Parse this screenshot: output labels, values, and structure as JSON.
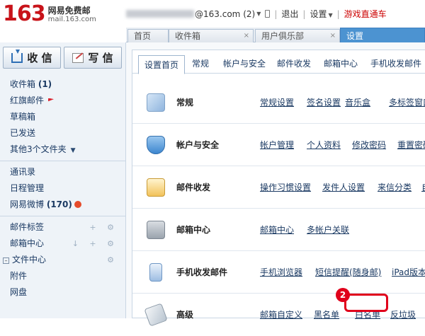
{
  "logo": {
    "number": "163",
    "name_cn": "网易免费邮",
    "domain": "mail.163.com"
  },
  "topbar": {
    "user_domain": "@163.com",
    "unread": "(2)",
    "logout": "退出",
    "settings": "设置",
    "game": "游戏直通车"
  },
  "tabs": [
    {
      "label": "首页"
    },
    {
      "label": "收件箱",
      "close": "×"
    },
    {
      "label": "用户俱乐部",
      "close": "×"
    },
    {
      "label": "设置"
    }
  ],
  "sidebar": {
    "receive": "收 信",
    "compose": "写 信",
    "items": [
      {
        "label": "收件箱",
        "count": "(1)"
      },
      {
        "label": "红旗邮件"
      },
      {
        "label": "草稿箱"
      },
      {
        "label": "已发送"
      },
      {
        "label": "其他3个文件夹"
      },
      {
        "label": "通讯录"
      },
      {
        "label": "日程管理"
      },
      {
        "label": "网易微博",
        "count": "(170)"
      },
      {
        "label": "邮件标签",
        "actions": "+ ⚙"
      },
      {
        "label": "邮箱中心",
        "actions": "↓ + ⚙"
      },
      {
        "label": "文件中心",
        "toggle": "–",
        "actions": "⚙"
      },
      {
        "label": "附件"
      },
      {
        "label": "网盘"
      }
    ]
  },
  "subtabs": [
    "设置首页",
    "常规",
    "帐户与安全",
    "邮件收发",
    "邮箱中心",
    "手机收发邮件"
  ],
  "rows": [
    {
      "title": "常规",
      "links": [
        "常规设置",
        "签名设置",
        "音乐盒",
        "多标签窗口"
      ]
    },
    {
      "title": "帐户与安全",
      "links": [
        "帐户管理",
        "个人资料",
        "修改密码",
        "重置密码"
      ]
    },
    {
      "title": "邮件收发",
      "links": [
        "操作习惯设置",
        "发件人设置",
        "来信分类",
        "自动"
      ]
    },
    {
      "title": "邮箱中心",
      "links": [
        "邮箱中心",
        "多帐户关联"
      ]
    },
    {
      "title": "手机收发邮件",
      "links": [
        "手机浏览器",
        "短信提醒(随身邮)",
        "iPad版本"
      ]
    },
    {
      "title": "高级",
      "links": [
        "邮箱自定义",
        "黑名单",
        "白名单",
        "反垃圾"
      ]
    }
  ],
  "annotation": {
    "step": "2"
  },
  "colors": {
    "brand_red": "#c8131a",
    "tab_active": "#4c93d1",
    "link": "#1b3a63",
    "highlight": "#e0001b"
  }
}
